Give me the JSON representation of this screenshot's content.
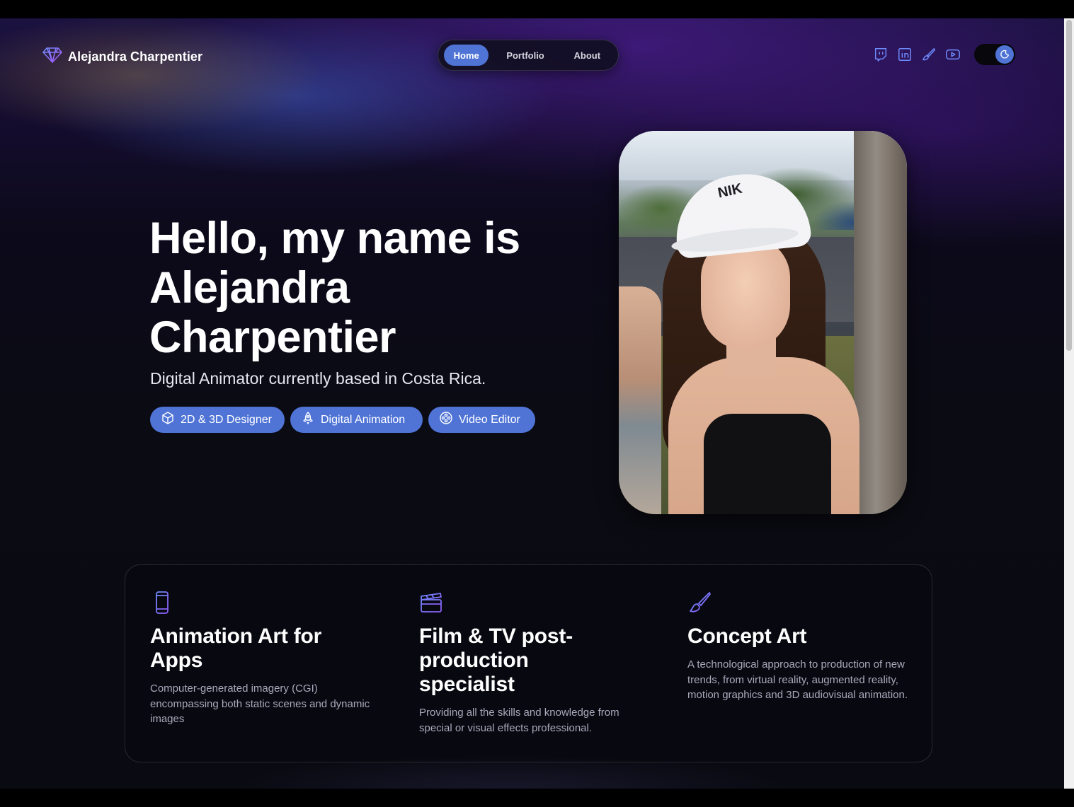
{
  "header": {
    "brand_name": "Alejandra Charpentier",
    "brand_icon": "diamond-icon",
    "nav": [
      {
        "label": "Home",
        "active": true
      },
      {
        "label": "Portfolio",
        "active": false
      },
      {
        "label": "About",
        "active": false
      }
    ],
    "socials": [
      "twitch-icon",
      "linkedin-icon",
      "brush-icon",
      "youtube-icon"
    ],
    "theme": "dark"
  },
  "hero": {
    "title": "Hello, my name is Alejandra Charpentier",
    "subtitle": "Digital Animator currently based in Costa Rica.",
    "chips": [
      {
        "label": "2D & 3D Designer",
        "icon": "cube-icon"
      },
      {
        "label": "Digital Animation",
        "icon": "rocket-icon"
      },
      {
        "label": "Video Editor",
        "icon": "film-reel-icon"
      }
    ],
    "portrait_cap_text": "NIK"
  },
  "features": [
    {
      "icon": "phone-icon",
      "title": "Animation Art for Apps",
      "description": "Computer-generated imagery (CGI) encompassing both static scenes and dynamic images"
    },
    {
      "icon": "clapperboard-icon",
      "title": "Film & TV post-production specialist",
      "description": "Providing all the skills and knowledge from special or visual effects professional."
    },
    {
      "icon": "brush-icon",
      "title": "Concept Art",
      "description": "A technological approach to production of new trends, from virtual reality, augmented reality, motion graphics and 3D audiovisual animation."
    }
  ],
  "colors": {
    "accent": "#4f74d6",
    "icon_gradient_start": "#4f74d6",
    "icon_gradient_end": "#8b5cf6",
    "background": "#0b0b14"
  }
}
